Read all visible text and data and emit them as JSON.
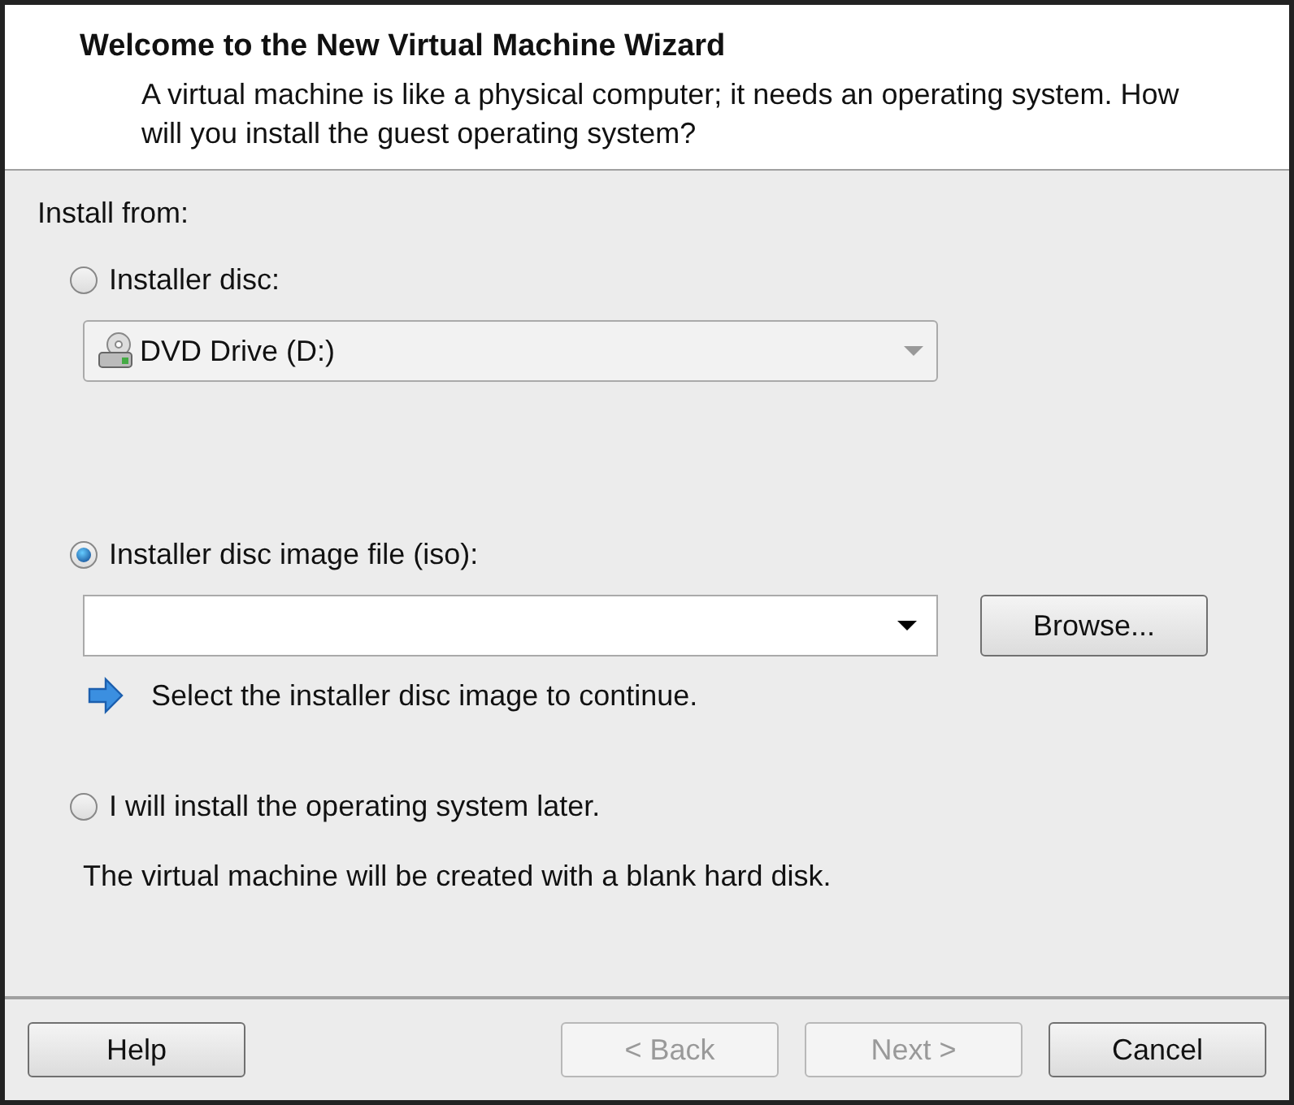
{
  "header": {
    "title": "Welcome to the New Virtual Machine Wizard",
    "description": "A virtual machine is like a physical computer; it needs an operating system. How will you install the guest operating system?"
  },
  "install_from_label": "Install from:",
  "options": [
    {
      "kind": "disc",
      "label": "Installer disc:",
      "selected": false,
      "dropdown": {
        "value": "DVD Drive (D:)",
        "disabled": true
      }
    },
    {
      "kind": "image",
      "label": "Installer disc image file (iso):",
      "selected": true,
      "browse_button": "Browse...",
      "hint": "Select the installer disc image to continue."
    },
    {
      "kind": "later",
      "label": "I will install the operating system later.",
      "selected": false,
      "note": "The virtual machine will be created with a blank hard disk."
    }
  ],
  "buttons": [
    {
      "label": "Help",
      "disabled": false
    },
    {
      "label": "< Back",
      "disabled": true
    },
    {
      "label": "Next >",
      "disabled": true
    },
    {
      "label": "Cancel",
      "disabled": false
    }
  ]
}
